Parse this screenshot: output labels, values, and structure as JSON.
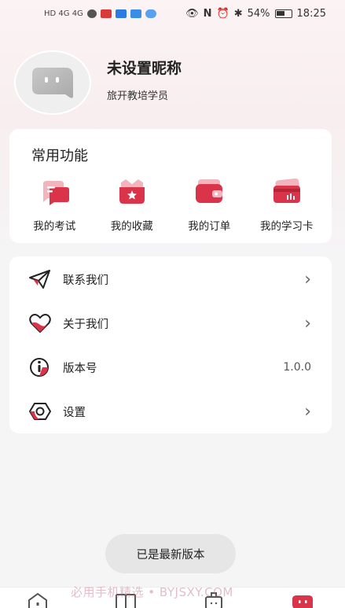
{
  "status_bar": {
    "left_text": "HD 4G 4G",
    "battery": "54%",
    "time": "18:25"
  },
  "profile": {
    "nickname": "未设置昵称",
    "role": "旅开教培学员"
  },
  "functions": {
    "title": "常用功能",
    "items": [
      {
        "label": "我的考试",
        "icon": "chat-bubble-icon"
      },
      {
        "label": "我的收藏",
        "icon": "star-badge-icon"
      },
      {
        "label": "我的订单",
        "icon": "wallet-icon"
      },
      {
        "label": "我的学习卡",
        "icon": "card-icon"
      }
    ]
  },
  "menu": {
    "items": [
      {
        "label": "联系我们",
        "icon": "paper-plane-icon",
        "right": "›"
      },
      {
        "label": "关于我们",
        "icon": "heart-icon",
        "right": "›"
      },
      {
        "label": "版本号",
        "icon": "info-icon",
        "right": "1.0.0"
      },
      {
        "label": "设置",
        "icon": "settings-icon",
        "right": "›"
      }
    ]
  },
  "toast": "已是最新版本",
  "watermark": "必用手机精选 • BYJSXY.COM",
  "colors": {
    "accent": "#d9344a",
    "background": "#f5f5f6"
  }
}
